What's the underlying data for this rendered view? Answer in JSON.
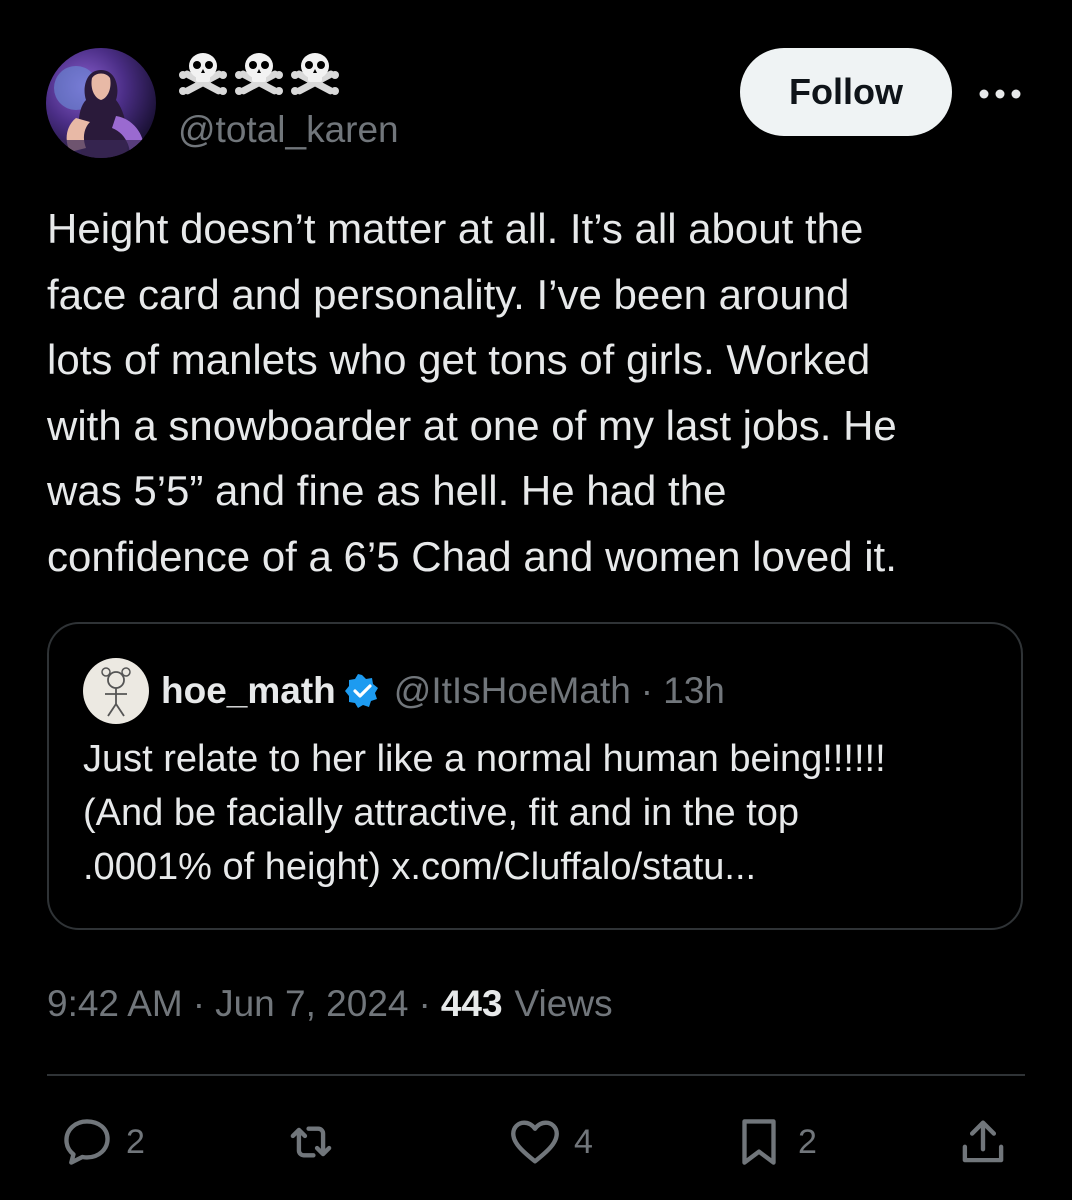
{
  "author": {
    "display_name": "☠☠☠",
    "handle": "@total_karen",
    "avatar_icon": "user-avatar"
  },
  "follow_label": "Follow",
  "more_icon": "more-dots-icon",
  "tweet": {
    "text": "Height doesn’t matter at all. It’s all about the\nface card and personality. I’ve been around\nlots of manlets who get tons of girls. Worked\nwith a snowboarder at one of my last jobs. He\nwas 5’5” and fine as hell. He had the\nconfidence of a 6’5 Chad and women loved it."
  },
  "quote": {
    "name": "hoe_math",
    "handle": "@ItIsHoeMath",
    "separator": "·",
    "time": "13h",
    "text": "Just relate to her like a normal human being!!!!!!\n(And be facially attractive, fit and in the top\n.0001% of height) x.com/Cluffalo/statu..."
  },
  "meta": {
    "time": "9:42 AM",
    "sep1": "·",
    "date": "Jun 7, 2024",
    "sep2": "·",
    "views_count": "443",
    "views_label": "Views"
  },
  "actions": {
    "replies": "2",
    "likes": "4",
    "bookmarks": "2"
  },
  "colors": {
    "background": "#000000",
    "text": "#e7e9ea",
    "secondary": "#71767b",
    "border": "#2f3336",
    "verified": "#1d9bf0",
    "follow_bg": "#eff3f4"
  }
}
